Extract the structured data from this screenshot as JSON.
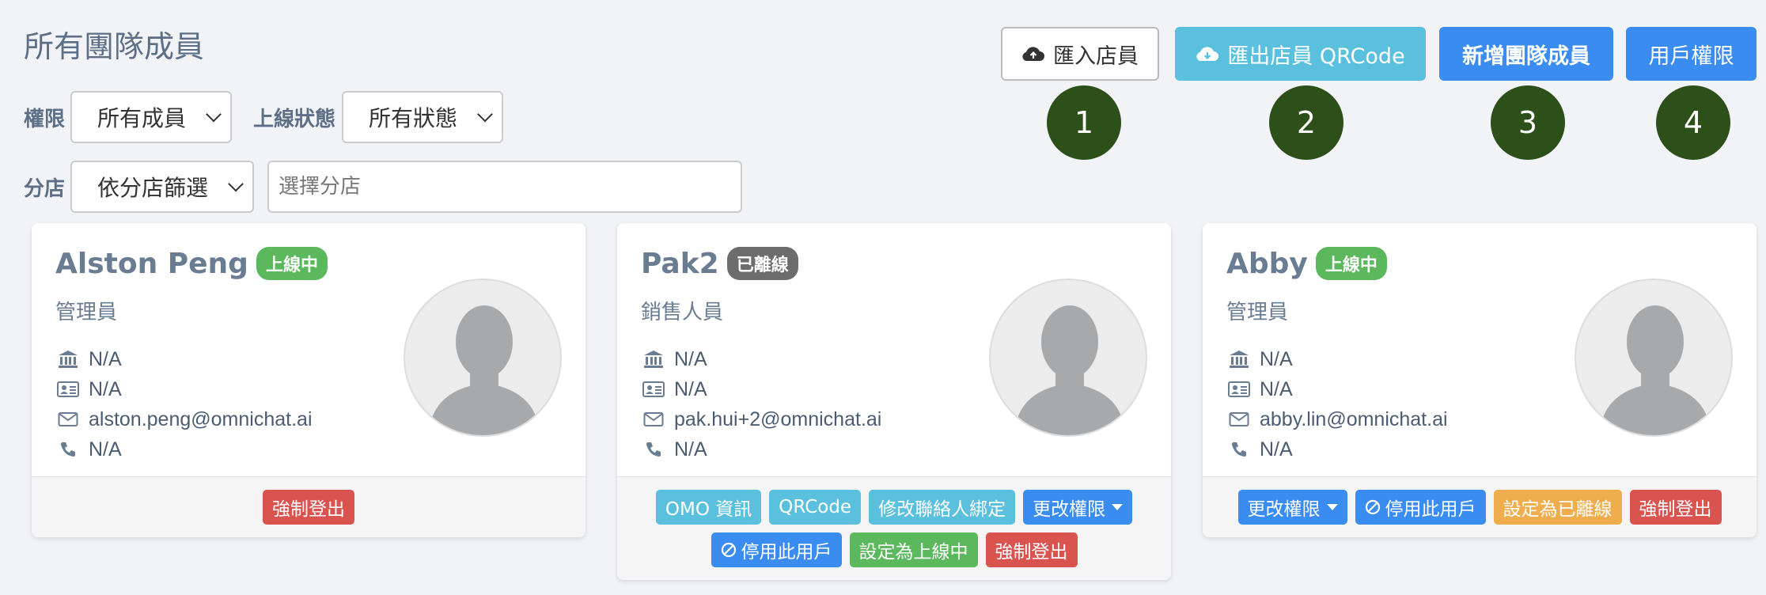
{
  "page": {
    "title": "所有團隊成員"
  },
  "filters": {
    "permission_label": "權限",
    "permission_value": "所有成員",
    "online_label": "上線狀態",
    "online_value": "所有狀態",
    "branch_label": "分店",
    "branch_value": "依分店篩選",
    "branch_placeholder": "選擇分店"
  },
  "toolbar": {
    "import_label": "匯入店員",
    "export_label": "匯出店員 QRCode",
    "new_member_label": "新增團隊成員",
    "user_permission_label": "用戶權限"
  },
  "markers": [
    "1",
    "2",
    "3",
    "4"
  ],
  "members": [
    {
      "name": "Alston Peng",
      "status": "上線中",
      "role": "管理員",
      "branch": "N/A",
      "id_card": "N/A",
      "email": "alston.peng@omnichat.ai",
      "phone": "N/A",
      "actions": {
        "force_logout": "強制登出"
      }
    },
    {
      "name": "Pak2",
      "status": "已離線",
      "role": "銷售人員",
      "branch": "N/A",
      "id_card": "N/A",
      "email": "pak.hui+2@omnichat.ai",
      "phone": "N/A",
      "actions": {
        "omo_info": "OMO 資訊",
        "qrcode": "QRCode",
        "edit_binding": "修改聯絡人綁定",
        "change_permission": "更改權限",
        "disable_user": "停用此用戶",
        "set_online": "設定為上線中",
        "force_logout": "強制登出"
      }
    },
    {
      "name": "Abby",
      "status": "上線中",
      "role": "管理員",
      "branch": "N/A",
      "id_card": "N/A",
      "email": "abby.lin@omnichat.ai",
      "phone": "N/A",
      "actions": {
        "change_permission": "更改權限",
        "disable_user": "停用此用戶",
        "set_offline": "設定為已離線",
        "force_logout": "強制登出"
      }
    }
  ],
  "colors": {
    "online": "#5cb85c",
    "offline": "#6c6c6c",
    "info": "#5bc0de",
    "primary": "#3b8cf0",
    "warning": "#f0ad4e",
    "danger": "#d9534f",
    "marker": "#2d4f1a"
  },
  "icons": [
    "cloud-upload-icon",
    "cloud-download-icon",
    "bank-icon",
    "id-card-icon",
    "envelope-icon",
    "phone-icon",
    "ban-icon",
    "caret-down-icon",
    "avatar-placeholder"
  ]
}
